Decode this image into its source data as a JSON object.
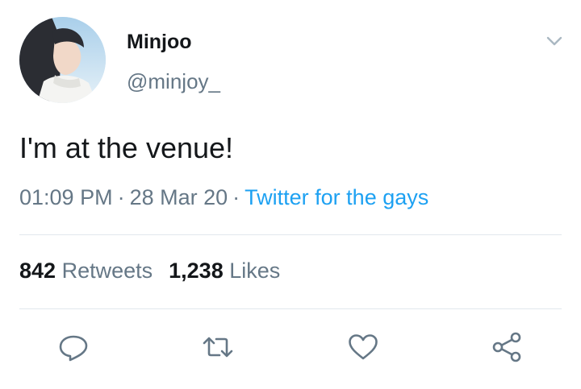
{
  "tweet": {
    "author": {
      "display_name": "Minjoo",
      "handle": "@minjoy_",
      "avatar_icon": "profile-photo"
    },
    "text": "I'm at the venue!",
    "time": "01:09 PM",
    "date": "28 Mar 20",
    "separator": "·",
    "source": "Twitter for the gays"
  },
  "stats": {
    "retweets_count": "842",
    "retweets_label": "Retweets",
    "likes_count": "1,238",
    "likes_label": "Likes"
  },
  "actions": [
    "reply-icon",
    "retweet-icon",
    "like-icon",
    "share-icon"
  ],
  "colors": {
    "text": "#14171a",
    "muted": "#657786",
    "link": "#1da1f2",
    "divider": "#e1e8ed",
    "icon": "#657786"
  }
}
